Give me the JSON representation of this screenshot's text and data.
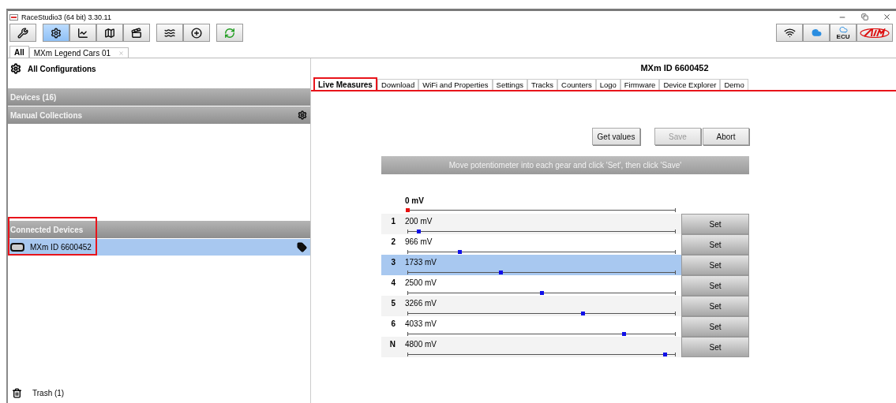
{
  "window": {
    "title": "RaceStudio3 (64 bit) 3.30.11"
  },
  "toolbar": {
    "left": [
      {
        "selected": false
      },
      {
        "selected": true
      },
      {
        "selected": false
      },
      {
        "selected": false
      },
      {
        "selected": false
      },
      {
        "selected": false
      },
      {
        "selected": false
      },
      {
        "selected": false
      }
    ],
    "ecu_label": "ECU"
  },
  "config_tabs": [
    {
      "label": "All",
      "selected": true,
      "closable": false
    },
    {
      "label": "MXm Legend Cars 01",
      "selected": false,
      "closable": true
    }
  ],
  "sidebar": {
    "title": "All Configurations",
    "sections": [
      {
        "label": "Devices  (16)",
        "settings": false
      },
      {
        "label": "Manual Collections",
        "settings": true
      }
    ],
    "connected": {
      "label": "Connected Devices",
      "highlighted": true,
      "items": [
        {
          "label": "MXm ID 6600452",
          "selected": true
        }
      ]
    },
    "trash": "Trash (1)"
  },
  "device": {
    "title": "MXm ID 6600452",
    "tabs": [
      {
        "label": "Live Measures",
        "selected": true,
        "highlighted": true
      },
      {
        "label": "Download",
        "selected": false,
        "highlighted": false
      },
      {
        "label": "WiFi and Properties",
        "selected": false,
        "highlighted": false
      },
      {
        "label": "Settings",
        "selected": false,
        "highlighted": false
      },
      {
        "label": "Tracks",
        "selected": false,
        "highlighted": false
      },
      {
        "label": "Counters",
        "selected": false,
        "highlighted": false
      },
      {
        "label": "Logo",
        "selected": false,
        "highlighted": false
      },
      {
        "label": "Firmware",
        "selected": false,
        "highlighted": false
      },
      {
        "label": "Device Explorer",
        "selected": false,
        "highlighted": false
      },
      {
        "label": "Demo",
        "selected": false,
        "highlighted": false
      }
    ],
    "buttons": [
      {
        "label": "Get values",
        "disabled": false
      },
      {
        "label": "Save",
        "disabled": true
      },
      {
        "label": "Abort",
        "disabled": false
      }
    ],
    "instruction": "Move potentiometer into each gear and click 'Set', then click 'Save'",
    "current": {
      "reading": "0 mV",
      "level": 0
    },
    "gears": [
      {
        "gear": "1",
        "reading": "200 mV",
        "level": 0.04,
        "selected": false,
        "button": "Set"
      },
      {
        "gear": "2",
        "reading": "966 mV",
        "level": 0.193,
        "selected": false,
        "button": "Set"
      },
      {
        "gear": "3",
        "reading": "1733 mV",
        "level": 0.347,
        "selected": true,
        "button": "Set"
      },
      {
        "gear": "4",
        "reading": "2500 mV",
        "level": 0.5,
        "selected": false,
        "button": "Set"
      },
      {
        "gear": "5",
        "reading": "3266 mV",
        "level": 0.653,
        "selected": false,
        "button": "Set"
      },
      {
        "gear": "6",
        "reading": "4033 mV",
        "level": 0.807,
        "selected": false,
        "button": "Set"
      },
      {
        "gear": "N",
        "reading": "4800 mV",
        "level": 0.96,
        "selected": false,
        "button": "Set"
      }
    ]
  }
}
